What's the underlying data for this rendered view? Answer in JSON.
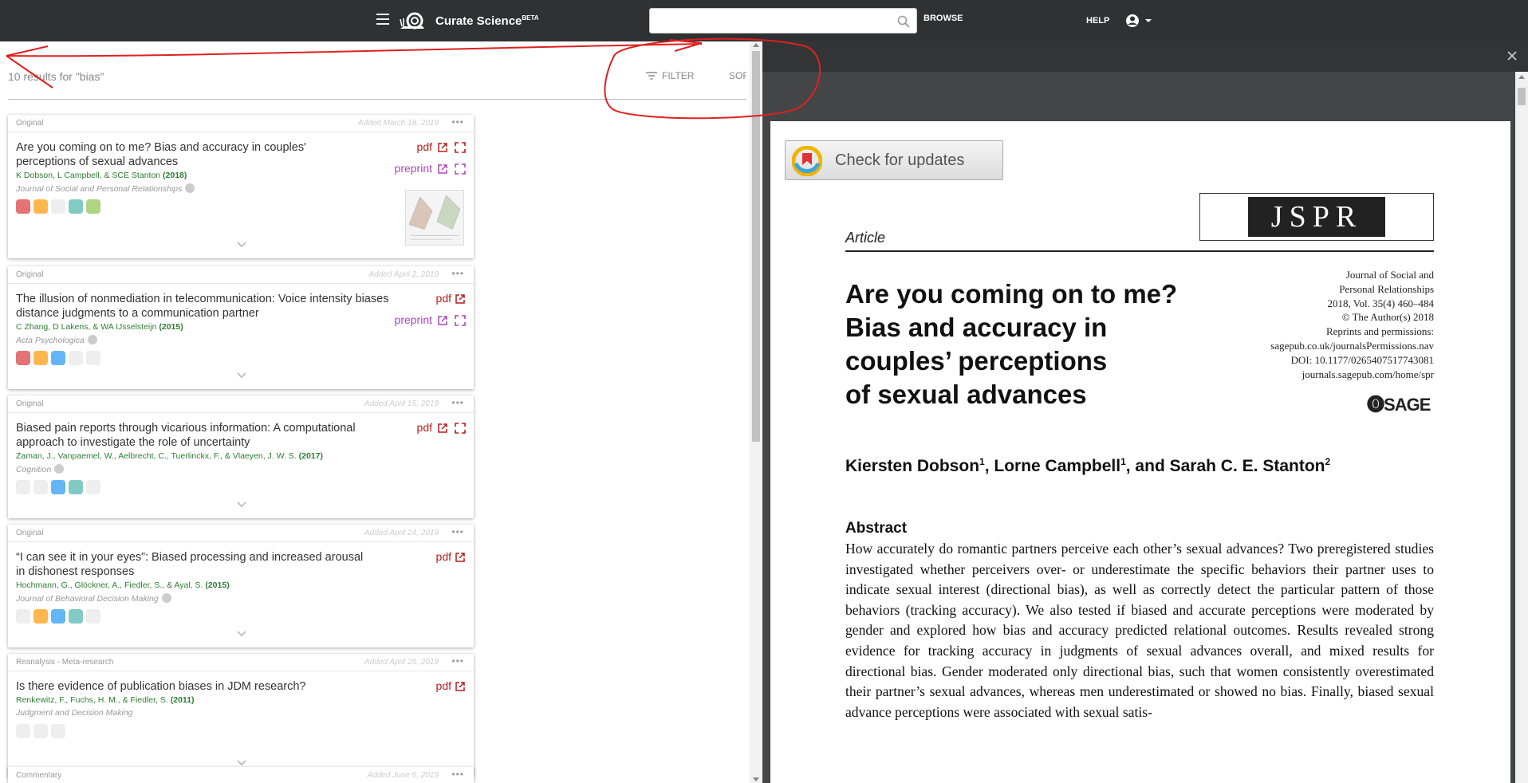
{
  "app": {
    "brand": "Curate Science",
    "brand_sup": "BETA",
    "browse_label": "BROWSE",
    "help_label": "HELP"
  },
  "search": {
    "placeholder": "",
    "value": ""
  },
  "results": {
    "count_text": "10 results for \"bias\"",
    "filter_label": "FILTER",
    "sort_label": "SORT"
  },
  "cards": [
    {
      "type": "Original",
      "date": "Added March 18, 2019",
      "title": "Are you coming on to me? Bias and accuracy in couples' perceptions of sexual advances",
      "authors": "K Dobson, L Campbell, & SCE Stanton",
      "year": "(2018)",
      "journal": "Journal of Social and Personal Relationships",
      "pdf": "pdf",
      "preprint": "preprint",
      "badges": [
        "#e57373",
        "#ffb74d",
        "#e0e0e0",
        "#80cbc4",
        "#aed581"
      ]
    },
    {
      "type": "Original",
      "date": "Added April 2, 2019",
      "title": "The illusion of nonmediation in telecommunication: Voice intensity biases distance judgments to a communication partner",
      "authors": "C Zhang, D Lakens, & WA IJsselsteijn",
      "year": "(2015)",
      "journal": "Acta Psychologica",
      "pdf": "pdf",
      "preprint": "preprint",
      "badges": [
        "#e57373",
        "#ffb74d",
        "#64b5f6",
        "#eeeeee",
        "#eeeeee"
      ]
    },
    {
      "type": "Original",
      "date": "Added April 15, 2019",
      "title": "Biased pain reports through vicarious information: A computational approach to investigate the role of uncertainty",
      "authors": "Zaman, J., Vanpaemel, W., Aelbrecht, C., Tuerlinckx, F., & Vlaeyen, J. W. S.",
      "year": "(2017)",
      "journal": "Cognition",
      "pdf": "pdf",
      "badges": [
        "#eeeeee",
        "#eeeeee",
        "#64b5f6",
        "#80cbc4",
        "#eeeeee"
      ]
    },
    {
      "type": "Original",
      "date": "Added April 24, 2019",
      "title": "“I can see it in your eyes”: Biased processing and increased arousal in dishonest responses",
      "authors": "Hochmann, G., Glöckner, A., Fiedler, S., & Ayal, S.",
      "year": "(2015)",
      "journal": "Journal of Behavioral Decision Making",
      "pdf": "pdf",
      "badges": [
        "#eeeeee",
        "#ffb74d",
        "#64b5f6",
        "#80cbc4",
        "#eeeeee"
      ]
    },
    {
      "type": "Reanalysis - Meta-research",
      "date": "Added April 25, 2019",
      "title": "Is there evidence of publication biases in JDM research?",
      "authors": "Renkewitz, F., Fuchs, H. M., & Fiedler, S.",
      "year": "(2011)",
      "journal": "Judgment and Decision Making",
      "pdf": "pdf",
      "badges": [
        "#eeeeee",
        "#eeeeee",
        "#eeeeee"
      ]
    },
    {
      "type": "Commentary",
      "date": "Added June 6, 2019"
    }
  ],
  "viewer": {
    "check_updates": "Check for updates",
    "journal_logo": "JSPR",
    "article_label": "Article",
    "title_lines": [
      "Are you coming on to me?",
      "Bias and accuracy in",
      "couples’ perceptions",
      "of sexual advances"
    ],
    "meta_lines": [
      "Journal of Social and",
      "Personal Relationships",
      "2018, Vol. 35(4) 460–484",
      "© The Author(s) 2018",
      "Reprints and permissions:",
      "sagepub.co.uk/journalsPermissions.nav",
      "DOI: 10.1177/0265407517743081",
      "journals.sagepub.com/home/spr"
    ],
    "publisher": "SAGE",
    "authors": [
      {
        "name": "Kiersten Dobson",
        "sup": "1"
      },
      {
        "name": ", Lorne Campbell",
        "sup": "1"
      },
      {
        "name": ", and Sarah C. E. Stanton",
        "sup": "2"
      }
    ],
    "abstract_heading": "Abstract",
    "abstract_text": "How accurately do romantic partners perceive each other’s sexual advances? Two preregistered studies investigated whether perceivers over- or underestimate the specific behaviors their partner uses to indicate sexual interest (directional bias), as well as correctly detect the particular pattern of those behaviors (tracking accuracy). We also tested if biased and accurate perceptions were moderated by gender and explored how bias and accuracy predicted relational outcomes. Results revealed strong evidence for tracking accuracy in judgments of sexual advances overall, and mixed results for directional bias. Gender moderated only directional bias, such that women consistently overestimated their partner’s sexual advances, whereas men underestimated or showed no bias. Finally, biased sexual advance perceptions were associated with sexual satis-"
  },
  "colors": {
    "topbar": "#2f3132",
    "pdf_red": "#b71c1c",
    "preprint_purple": "#ab47bc",
    "author_green": "#2e7d32",
    "annotation_red": "#e02020"
  }
}
